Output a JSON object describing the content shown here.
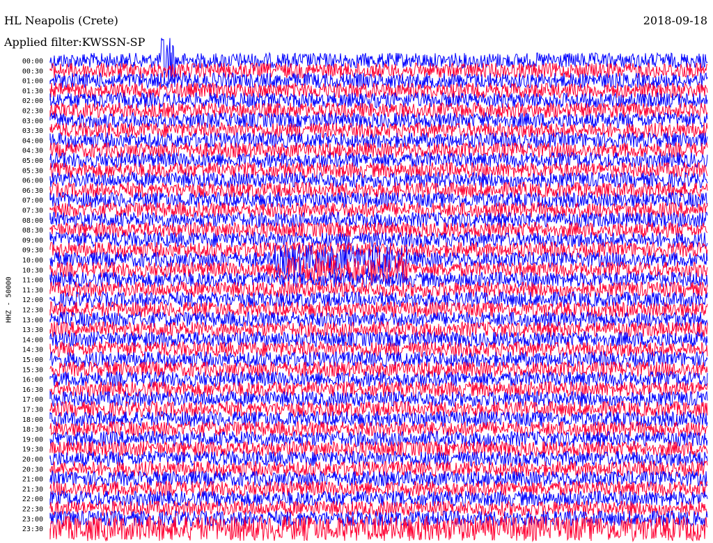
{
  "header": {
    "station": "HL Neapolis (Crete)",
    "date": "2018-09-18",
    "filter": "Applied filter:KWSSN-SP"
  },
  "chart_data": {
    "type": "line",
    "title": "HL Neapolis (Crete)",
    "date": "2018-09-18",
    "ylabel": "HHZ - 50000",
    "row_labels": [
      "00:00",
      "00:30",
      "01:00",
      "01:30",
      "02:00",
      "02:30",
      "03:00",
      "03:30",
      "04:00",
      "04:30",
      "05:00",
      "05:30",
      "06:00",
      "06:30",
      "07:00",
      "07:30",
      "08:00",
      "08:30",
      "09:00",
      "09:30",
      "10:00",
      "10:30",
      "11:00",
      "11:30",
      "12:00",
      "12:30",
      "13:00",
      "13:30",
      "14:00",
      "14:30",
      "15:00",
      "15:30",
      "16:00",
      "16:30",
      "17:00",
      "17:30",
      "18:00",
      "18:30",
      "19:00",
      "19:30",
      "20:00",
      "20:30",
      "21:00",
      "21:30",
      "22:00",
      "22:30",
      "23:00",
      "23:30"
    ],
    "series_colors": [
      "#0000ff",
      "#ff0033"
    ]
  }
}
